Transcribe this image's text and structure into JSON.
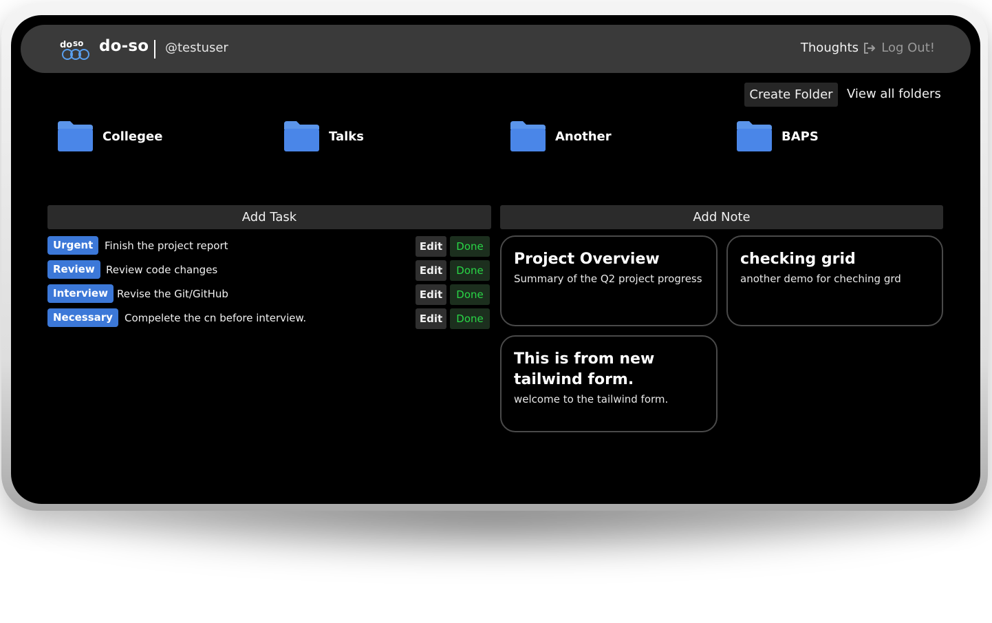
{
  "navbar": {
    "brand": "do-so",
    "username": "@testuser",
    "thoughts_label": "Thoughts",
    "logout_label": "Log Out!"
  },
  "folders_toolbar": {
    "create_label": "Create Folder",
    "view_all_label": "View all folders"
  },
  "folders": [
    {
      "name": "Collegee",
      "icon": "folder-icon"
    },
    {
      "name": "Talks",
      "icon": "folder-icon"
    },
    {
      "name": "Another",
      "icon": "folder-icon"
    },
    {
      "name": "BAPS",
      "icon": "folder-icon"
    }
  ],
  "tasks_panel": {
    "add_label": "Add Task",
    "edit_label": "Edit",
    "done_label": "Done",
    "items": [
      {
        "tag": "Urgent",
        "text": "Finish the project report"
      },
      {
        "tag": "Review",
        "text": "Review code changes"
      },
      {
        "tag": "Interview",
        "text": "Revise the Git/GitHub"
      },
      {
        "tag": "Necessary",
        "text": "Compelete the cn before interview."
      }
    ]
  },
  "notes_panel": {
    "add_label": "Add Note",
    "notes": [
      {
        "title": "Project Overview",
        "body": "Summary of the Q2 project progress"
      },
      {
        "title": "checking grid",
        "body": "another demo for cheching grd"
      },
      {
        "title": "This is from new tailwind form.",
        "body": "welcome to the tailwind form."
      }
    ]
  },
  "colors": {
    "tag_blue": "#3c78d8",
    "done_green": "#29d646",
    "navbar_bg": "#3a3a3a",
    "folder_blue": "#4a86e8"
  }
}
